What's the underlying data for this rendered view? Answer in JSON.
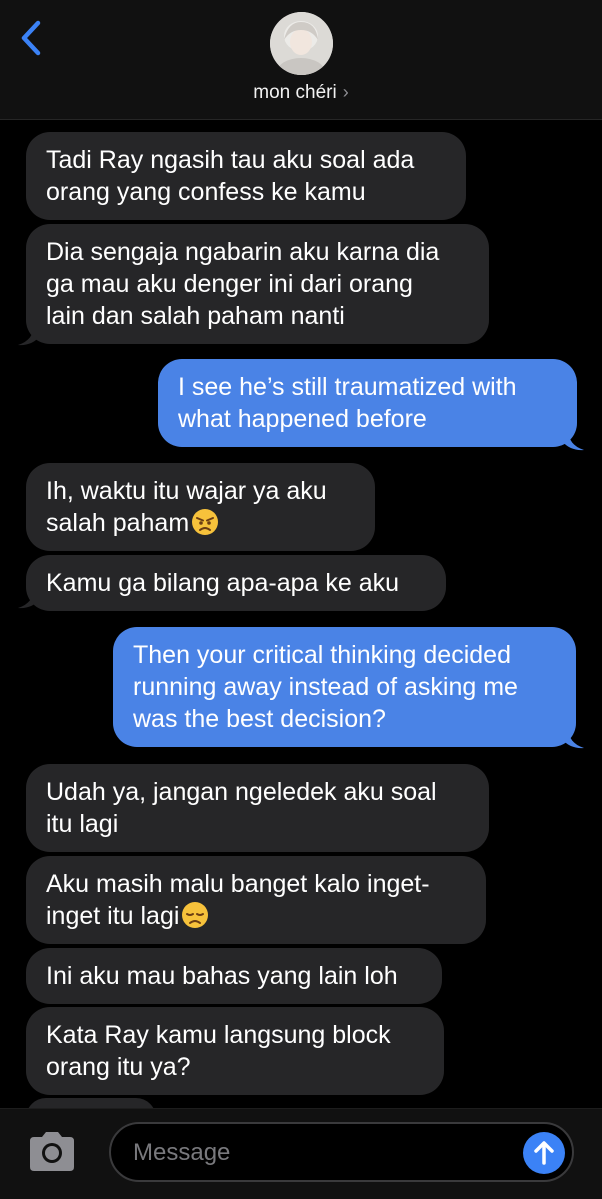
{
  "header": {
    "contact_name": "mon chéri",
    "chevron": "›",
    "back_icon": "chevron-left-icon"
  },
  "messages": [
    {
      "side": "in",
      "lines": [
        "Tadi Ray ngasih tau aku soal ada",
        "orang yang confess ke kamu"
      ]
    },
    {
      "side": "in",
      "lines": [
        "Dia sengaja ngabarin aku karna dia",
        "ga mau aku denger ini dari orang",
        "lain dan salah paham nanti"
      ]
    },
    {
      "side": "out",
      "lines": [
        "I see he’s still traumatized with",
        "what happened before"
      ]
    },
    {
      "side": "in",
      "lines": [
        "Ih, waktu itu wajar ya aku",
        "salah paham"
      ],
      "emoji": "angry-face"
    },
    {
      "side": "in",
      "lines": [
        "Kamu ga bilang apa-apa ke aku"
      ]
    },
    {
      "side": "out",
      "lines": [
        "Then your critical thinking decided",
        "running away instead of asking me",
        "was the best decision?"
      ]
    },
    {
      "side": "in",
      "lines": [
        "Udah ya, jangan ngeledek aku soal",
        "itu lagi"
      ]
    },
    {
      "side": "in",
      "lines": [
        "Aku masih malu banget kalo inget-",
        "inget itu lagi"
      ],
      "emoji": "disappointed-face"
    },
    {
      "side": "in",
      "lines": [
        "Ini aku mau bahas yang lain loh"
      ]
    },
    {
      "side": "in",
      "lines": [
        "Kata Ray kamu langsung block",
        "orang itu ya?"
      ]
    }
  ],
  "composer": {
    "placeholder": "Message",
    "camera_icon": "camera-icon",
    "send_icon": "arrow-up-icon"
  },
  "colors": {
    "incoming_bubble": "#262628",
    "outgoing_bubble": "#4a83e6",
    "accent": "#3b82f6"
  }
}
